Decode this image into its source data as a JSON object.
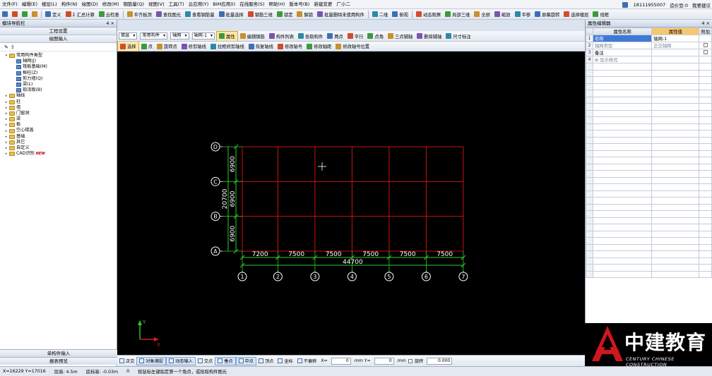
{
  "menu": {
    "items": [
      "文件(F)",
      "编辑(E)",
      "楼层(L)",
      "构件(N)",
      "绘图(D)",
      "修改(M)",
      "钢筋量(Q)",
      "视图(V)",
      "工具(T)",
      "云应用(Y)",
      "BIM应用(I)",
      "在线服务(S)",
      "帮助(H)",
      "版本号(B)",
      "新建变更",
      "广小二"
    ],
    "phone": "18111955007",
    "price": "造价豆:0",
    "right_action": "我要建议"
  },
  "toolbar1": {
    "items": [
      "定义",
      "Σ 汇总计算",
      "云检查",
      "平齐板顶",
      "查找图元",
      "查看钢筋量",
      "批量选择",
      "钢筋三维",
      "锁定",
      "解锁",
      "批量删除未使用构件",
      "二维",
      "俯视",
      "动态观察",
      "局部三维",
      "全屏",
      "缩放",
      "平移",
      "屏幕旋转",
      "选择楼层",
      "线框"
    ]
  },
  "sidebar": {
    "title": "模块导航栏",
    "pin": "4 ×",
    "btn_project": "工程设置",
    "btn_drawing": "绘图输入",
    "tree": [
      {
        "label": "常用构件类型",
        "level": 0,
        "kind": "folder",
        "open": true
      },
      {
        "label": "轴网(J)",
        "level": 1,
        "kind": "leaf"
      },
      {
        "label": "筏板基础(M)",
        "level": 1,
        "kind": "leaf"
      },
      {
        "label": "框柱(Z)",
        "level": 1,
        "kind": "leaf"
      },
      {
        "label": "剪力墙(Q)",
        "level": 1,
        "kind": "leaf"
      },
      {
        "label": "梁(L)",
        "level": 1,
        "kind": "leaf"
      },
      {
        "label": "现浇板(B)",
        "level": 1,
        "kind": "leaf"
      },
      {
        "label": "轴线",
        "level": 0,
        "kind": "folder"
      },
      {
        "label": "柱",
        "level": 0,
        "kind": "folder"
      },
      {
        "label": "墙",
        "level": 0,
        "kind": "folder"
      },
      {
        "label": "门窗洞",
        "level": 0,
        "kind": "folder"
      },
      {
        "label": "梁",
        "level": 0,
        "kind": "folder"
      },
      {
        "label": "板",
        "level": 0,
        "kind": "folder"
      },
      {
        "label": "空心楼盖",
        "level": 0,
        "kind": "folder"
      },
      {
        "label": "基础",
        "level": 0,
        "kind": "folder"
      },
      {
        "label": "其它",
        "level": 0,
        "kind": "folder"
      },
      {
        "label": "自定义",
        "level": 0,
        "kind": "folder"
      },
      {
        "label": "CAD识别",
        "level": 0,
        "kind": "folder",
        "badge": "NEW"
      }
    ],
    "btn_single": "单构件输入",
    "btn_report": "报表预览"
  },
  "ctrl1": {
    "floor": "首层",
    "type": "常用构件",
    "category": "轴网",
    "component": "轴网-1",
    "items": [
      "属性",
      "编辑钢筋",
      "构件列表",
      "拾取构件",
      "两点",
      "平行",
      "点角",
      "三点辅轴",
      "删除辅轴",
      "尺寸标注"
    ]
  },
  "ctrl2": {
    "items": [
      "选择",
      "点",
      "旋转点",
      "修剪轴线",
      "拉框修剪轴线",
      "恢复轴线",
      "修改轴号",
      "修改轴距",
      "修改轴号位置"
    ]
  },
  "grid": {
    "x_labels": [
      "1",
      "2",
      "3",
      "4",
      "5",
      "6",
      "7"
    ],
    "x_spans": [
      7200,
      7500,
      7500,
      7500,
      7500,
      7500
    ],
    "x_total": "44700",
    "y_labels": [
      "A",
      "B",
      "C",
      "D"
    ],
    "y_spans": [
      6900,
      6900,
      6900
    ],
    "y_total": "20700",
    "axis_y_label": "Y",
    "axis_x_label": "X"
  },
  "statusbar1": {
    "items": [
      "正交",
      "对象捕捉",
      "动态输入",
      "交点",
      "垂点",
      "中点",
      "顶点",
      "坐标",
      "不偏移"
    ],
    "x_label": "X=",
    "x_value": "0",
    "y_label": "mm Y=",
    "y_value": "0",
    "unit": "mm",
    "rotate_label": "旋转",
    "rotate_value": "0.000"
  },
  "statusbar2": {
    "coords": "X=16229 Y=17016",
    "floor_height": "层高: 4.5m",
    "base_elev": "底标高: -0.03m",
    "count": "0",
    "hint": "按鼠标左键指定第一个角点，或拾取构件图元"
  },
  "props": {
    "title": "属性编辑器",
    "pin": "4 ×",
    "col_name": "属性名称",
    "col_value": "属性值",
    "col_add": "附加",
    "rows": [
      {
        "num": "1",
        "name": "名称",
        "value": "轴网-1",
        "selected": true,
        "check": false
      },
      {
        "num": "2",
        "name": "轴网类型",
        "value": "正交轴网",
        "gray": true,
        "check": true
      },
      {
        "num": "3",
        "name": "备注",
        "value": "",
        "check": true
      },
      {
        "num": "4",
        "name": "显示样式",
        "value": "",
        "gray": true,
        "expand": true,
        "check": false
      }
    ]
  },
  "logo": {
    "cn": "中建教育",
    "en": "CENTURY CHINESE CONSTRUCTION",
    "colors": {
      "brand_red": "#d0161e",
      "brand_blue": "#1a4f9c"
    }
  },
  "colors": {
    "grid_line": "#cc1111",
    "dim_line": "#2ccc2c",
    "axis_circle": "#ffffff",
    "text": "#ffffff"
  }
}
